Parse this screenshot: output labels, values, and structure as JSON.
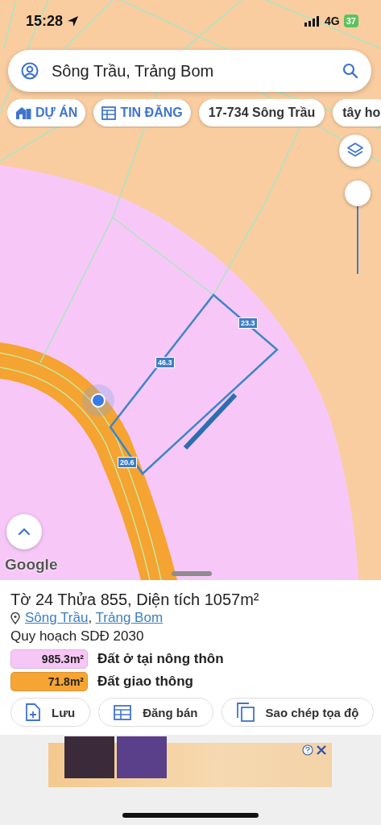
{
  "status_bar": {
    "time": "15:28",
    "network": "4G",
    "battery": "37"
  },
  "search": {
    "value": "Sông Trầu, Trảng Bom"
  },
  "chips": [
    {
      "kind": "project",
      "label": "DỰ ÁN"
    },
    {
      "kind": "listing",
      "label": "TIN ĐĂNG"
    },
    {
      "kind": "text",
      "label": "17-734 Sông Trầu"
    },
    {
      "kind": "text",
      "label": "tây ho"
    }
  ],
  "map": {
    "edge_lengths": [
      "46.3",
      "23.3",
      "20.6"
    ],
    "attribution": "Google",
    "zoom": {
      "level": 1
    }
  },
  "parcel": {
    "title": "Tờ 24 Thửa 855, Diện tích 1057m²",
    "address": {
      "links": [
        "Sông Trầu",
        "Trảng Bom"
      ],
      "separator": ","
    }
  },
  "plan": {
    "title": "Quy hoạch SDĐ 2030",
    "zones": [
      {
        "area": "985.3m²",
        "name": "Đất ở tại nông thôn",
        "color": "#f6c6f6"
      },
      {
        "area": "71.8m²",
        "name": "Đất giao thông",
        "color": "#f6a534"
      }
    ]
  },
  "actions": [
    {
      "kind": "save",
      "label": "Lưu"
    },
    {
      "kind": "post",
      "label": "Đăng bán"
    },
    {
      "kind": "copy",
      "label": "Sao chép tọa độ"
    }
  ]
}
